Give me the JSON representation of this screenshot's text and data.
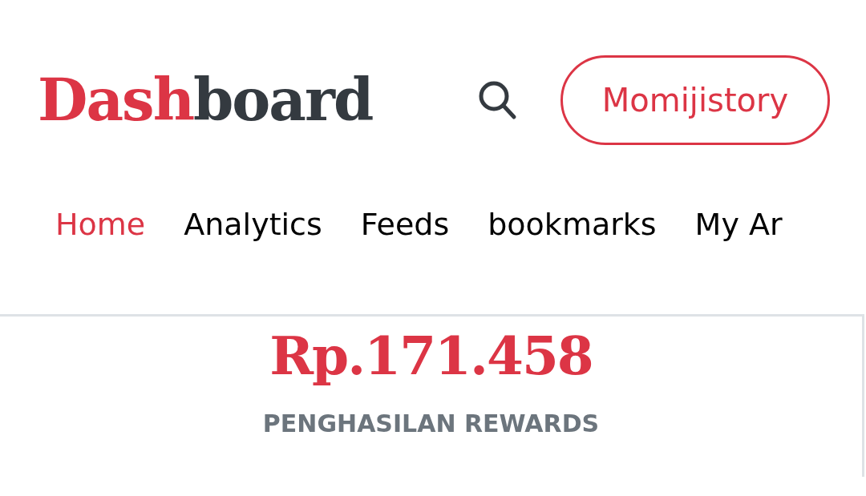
{
  "header": {
    "logo": {
      "accent": "Dash",
      "rest": "board"
    },
    "account_button": "Momijistory"
  },
  "tabs": [
    {
      "label": "Home",
      "selected": true
    },
    {
      "label": "Analytics",
      "selected": false
    },
    {
      "label": "Feeds",
      "selected": false
    },
    {
      "label": "bookmarks",
      "selected": false
    },
    {
      "label": "My Ar",
      "selected": false
    }
  ],
  "rewards_card": {
    "amount": "Rp.171.458",
    "label": "PENGHASILAN REWARDS"
  }
}
